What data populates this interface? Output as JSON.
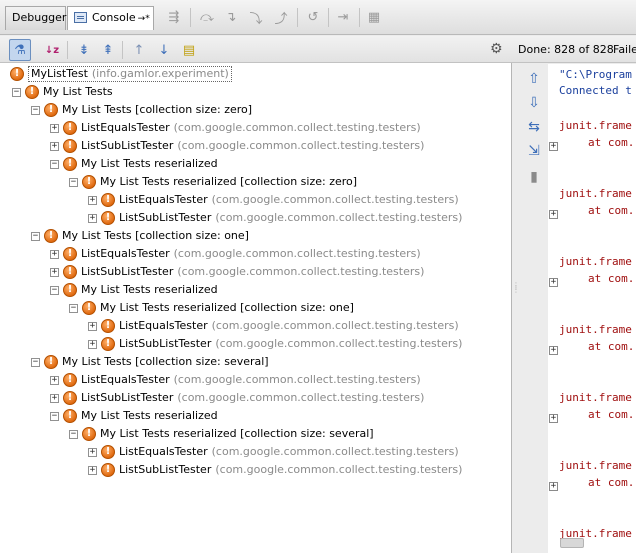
{
  "tabs": {
    "debugger": "Debugger",
    "console": "Console",
    "console_pin": "→*"
  },
  "runner": {
    "status": "Done: 828 of 828",
    "status_failed": "Faile"
  },
  "tree": [
    {
      "label": "MyListTest",
      "pkg": "(info.gamlor.experiment)"
    },
    {
      "label": "My List Tests",
      "pkg": ""
    },
    {
      "label": "My List Tests [collection size: zero]",
      "pkg": ""
    },
    {
      "label": "ListEqualsTester",
      "pkg": "(com.google.common.collect.testing.testers)"
    },
    {
      "label": "ListSubListTester",
      "pkg": "(com.google.common.collect.testing.testers)"
    },
    {
      "label": "My List Tests reserialized",
      "pkg": ""
    },
    {
      "label": "My List Tests reserialized [collection size: zero]",
      "pkg": ""
    },
    {
      "label": "ListEqualsTester",
      "pkg": "(com.google.common.collect.testing.testers)"
    },
    {
      "label": "ListSubListTester",
      "pkg": "(com.google.common.collect.testing.testers)"
    },
    {
      "label": "My List Tests [collection size: one]",
      "pkg": ""
    },
    {
      "label": "ListEqualsTester",
      "pkg": "(com.google.common.collect.testing.testers)"
    },
    {
      "label": "ListSubListTester",
      "pkg": "(com.google.common.collect.testing.testers)"
    },
    {
      "label": "My List Tests reserialized",
      "pkg": ""
    },
    {
      "label": "My List Tests reserialized [collection size: one]",
      "pkg": ""
    },
    {
      "label": "ListEqualsTester",
      "pkg": "(com.google.common.collect.testing.testers)"
    },
    {
      "label": "ListSubListTester",
      "pkg": "(com.google.common.collect.testing.testers)"
    },
    {
      "label": "My List Tests [collection size: several]",
      "pkg": ""
    },
    {
      "label": "ListEqualsTester",
      "pkg": "(com.google.common.collect.testing.testers)"
    },
    {
      "label": "ListSubListTester",
      "pkg": "(com.google.common.collect.testing.testers)"
    },
    {
      "label": "My List Tests reserialized",
      "pkg": ""
    },
    {
      "label": "My List Tests reserialized [collection size: several]",
      "pkg": ""
    },
    {
      "label": "ListEqualsTester",
      "pkg": "(com.google.common.collect.testing.testers)"
    },
    {
      "label": "ListSubListTester",
      "pkg": "(com.google.common.collect.testing.testers)"
    }
  ],
  "console": {
    "lines": [
      "\"C:\\Program",
      "Connected t",
      "junit.frame",
      "at com.",
      "junit.frame",
      "at com.",
      "junit.frame",
      "at com.",
      "junit.frame",
      "at com.",
      "junit.frame",
      "at com.",
      "junit.frame",
      "at com.",
      "junit.frame"
    ]
  }
}
